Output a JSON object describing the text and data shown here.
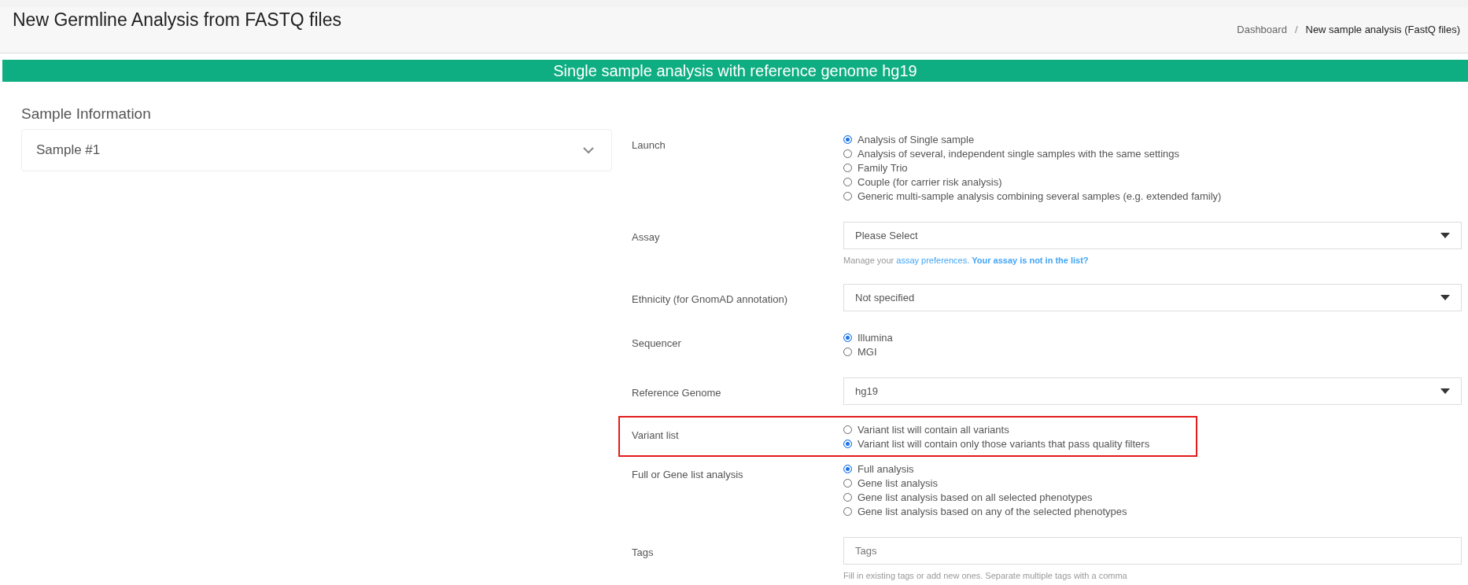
{
  "header": {
    "title": "New Germline Analysis from FASTQ files",
    "breadcrumb_separator": "/",
    "breadcrumb": [
      {
        "label": "Dashboard",
        "kind": "link"
      },
      {
        "label": "New sample analysis (FastQ files)",
        "kind": "current"
      }
    ]
  },
  "banner": "Single sample analysis with reference genome hg19",
  "sample_information": {
    "heading": "Sample Information",
    "samples": [
      {
        "label": "Sample #1",
        "expanded": false
      }
    ]
  },
  "form": [
    {
      "kind": "radio",
      "label": "Launch",
      "highlighted": false,
      "options": [
        {
          "label": "Analysis of Single sample",
          "selected": true
        },
        {
          "label": "Analysis of several, independent single samples with the same settings",
          "selected": false
        },
        {
          "label": "Family Trio",
          "selected": false
        },
        {
          "label": "Couple (for carrier risk analysis)",
          "selected": false
        },
        {
          "label": "Generic multi-sample analysis combining several samples (e.g. extended family)",
          "selected": false
        }
      ]
    },
    {
      "kind": "select",
      "label": "Assay",
      "highlighted": false,
      "value": "Please Select",
      "help": [
        {
          "kind": "text",
          "text": "Manage your "
        },
        {
          "kind": "link",
          "text": "assay preferences."
        },
        {
          "kind": "strong-link",
          "text": "Your assay is not in the list?"
        }
      ]
    },
    {
      "kind": "select",
      "label": "Ethnicity (for GnomAD annotation)",
      "highlighted": false,
      "value": "Not specified"
    },
    {
      "kind": "radio",
      "label": "Sequencer",
      "highlighted": false,
      "options": [
        {
          "label": "Illumina",
          "selected": true
        },
        {
          "label": "MGI",
          "selected": false
        }
      ]
    },
    {
      "kind": "select",
      "label": "Reference Genome",
      "highlighted": false,
      "value": "hg19"
    },
    {
      "kind": "radio",
      "label": "Variant list",
      "highlighted": true,
      "options": [
        {
          "label": "Variant list will contain all variants",
          "selected": false
        },
        {
          "label": "Variant list will contain only those variants that pass quality filters",
          "selected": true
        }
      ]
    },
    {
      "kind": "radio",
      "label": "Full or Gene list analysis",
      "highlighted": false,
      "options": [
        {
          "label": "Full analysis",
          "selected": true
        },
        {
          "label": "Gene list analysis",
          "selected": false
        },
        {
          "label": "Gene list analysis based on all selected phenotypes",
          "selected": false
        },
        {
          "label": "Gene list analysis based on any of the selected phenotypes",
          "selected": false
        }
      ]
    },
    {
      "kind": "input",
      "label": "Tags",
      "highlighted": false,
      "placeholder": "Tags",
      "help": [
        {
          "kind": "text",
          "text": "Fill in existing tags or add new ones. Separate multiple tags with a comma"
        }
      ]
    }
  ]
}
